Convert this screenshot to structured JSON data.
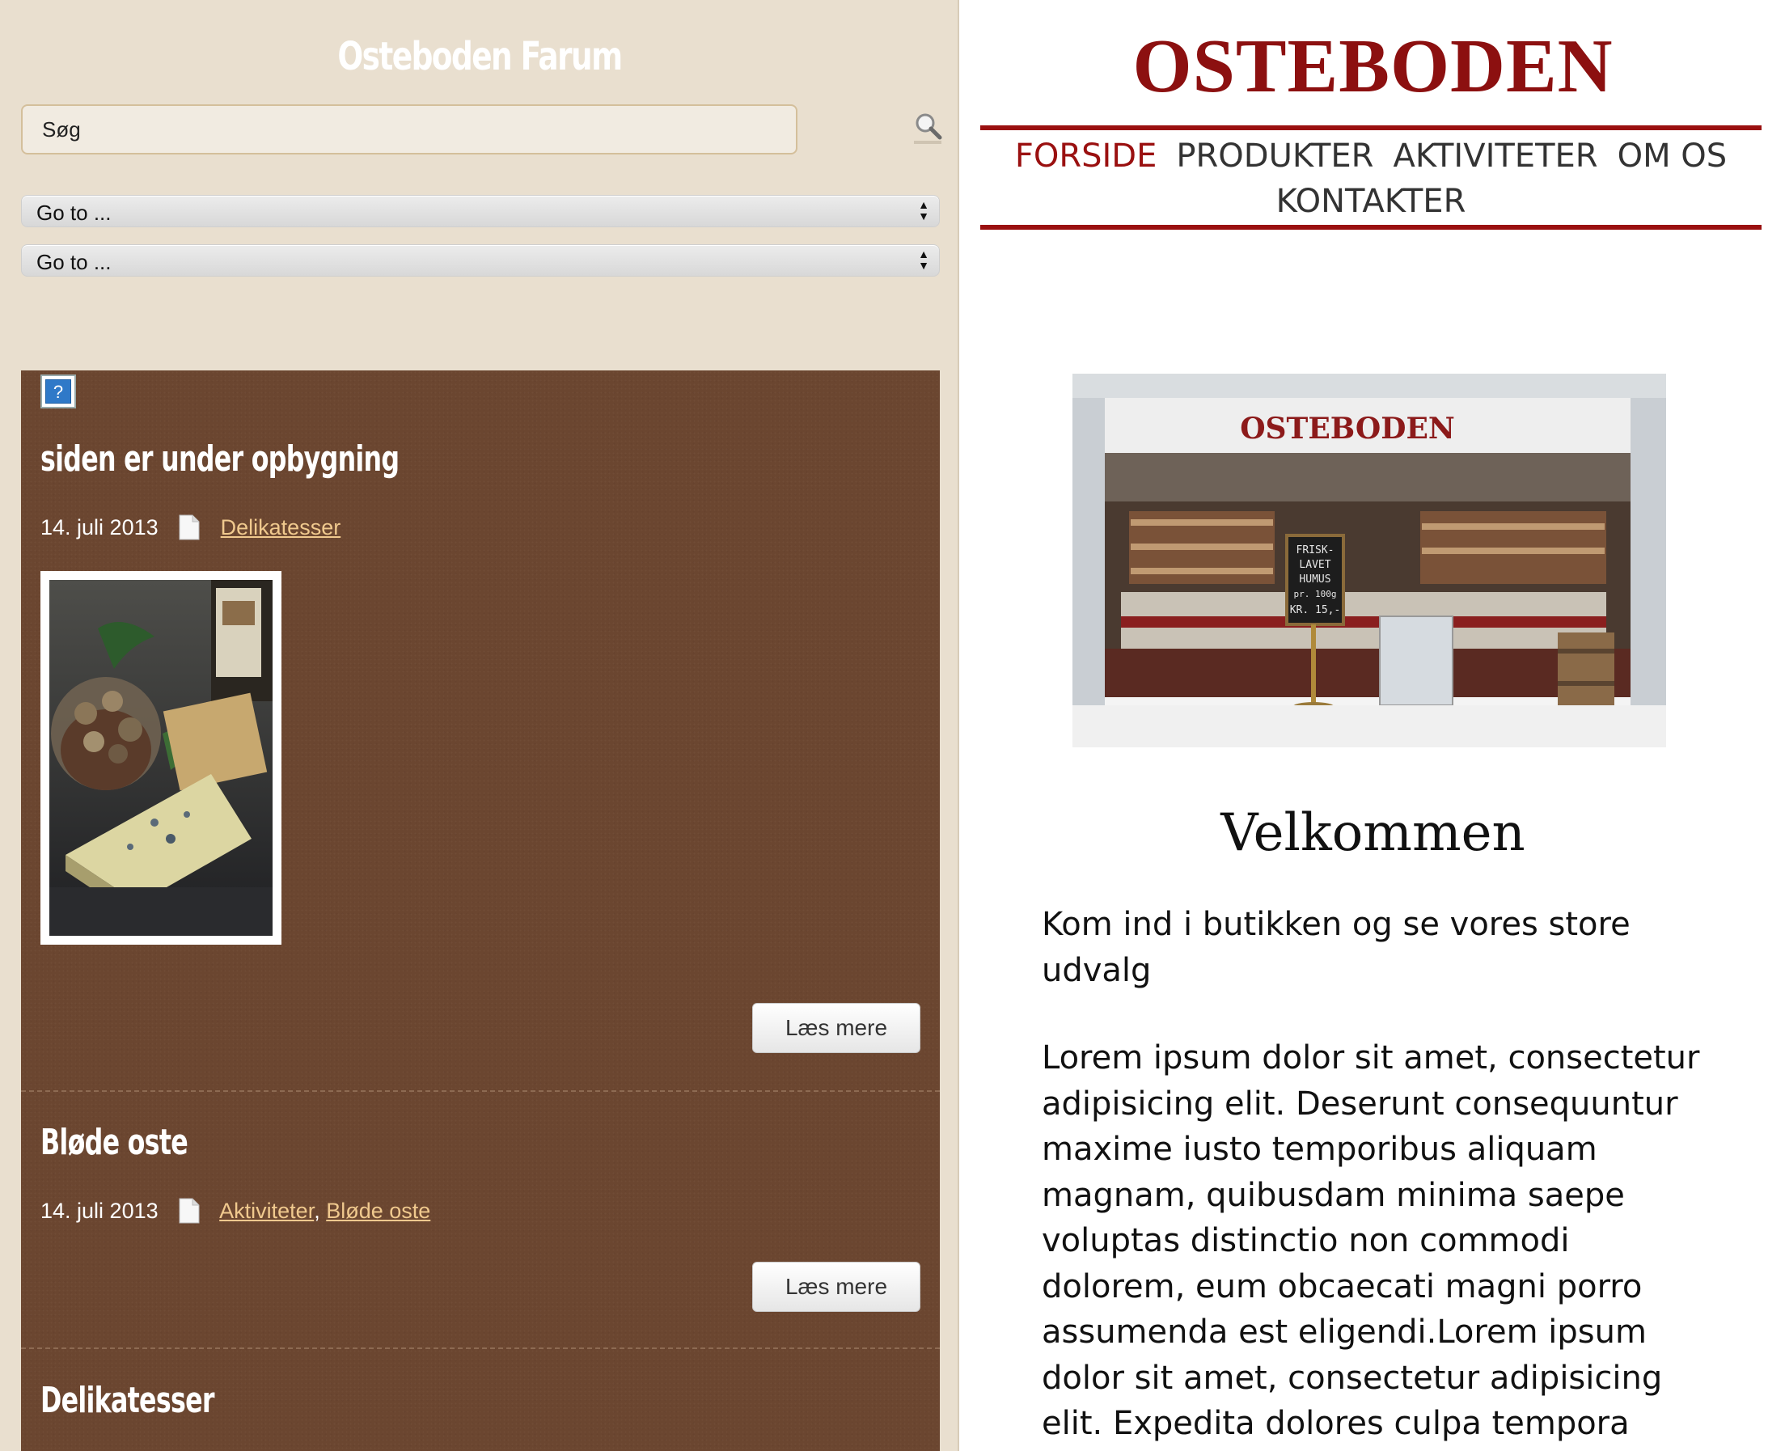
{
  "left": {
    "site_title": "Osteboden Farum",
    "search_placeholder": "Søg",
    "goto_1": "Go to ...",
    "goto_2": "Go to ...",
    "posts": [
      {
        "title": "siden er under opbygning",
        "date": "14. juli 2013",
        "categories": [
          "Delikatesser"
        ],
        "read_more": "Læs mere"
      },
      {
        "title": "Bløde oste",
        "date": "14. juli 2013",
        "categories": [
          "Aktiviteter",
          "Bløde oste"
        ],
        "category_separator": ",",
        "read_more": "Læs mere"
      },
      {
        "title": "Delikatesser"
      }
    ]
  },
  "right": {
    "brand": "OSTEBODEN",
    "nav": [
      "FORSIDE",
      "PRODUKTER",
      "AKTIVITETER",
      "OM OS",
      "KONTAKTER"
    ],
    "photo_sign": "OSTEBODEN",
    "photo_chalkboard": [
      "FRISK-",
      "LAVET",
      "HUMUS",
      "pr. 100g",
      "KR. 15,-"
    ],
    "welcome": "Velkommen",
    "lead": "Kom ind i butikken og se vores store udvalg",
    "body": "Lorem ipsum dolor sit amet, consectetur adipisicing elit. Deserunt consequuntur maxime iusto temporibus aliquam magnam, quibusdam minima saepe voluptas distinctio non commodi dolorem, eum obcaecati magni porro assumenda est eligendi.Lorem ipsum dolor sit amet, consectetur adipisicing elit. Expedita dolores culpa tempora ducimus quae, nisi"
  },
  "colors": {
    "left_bg": "#e9dfcf",
    "content_brown": "#6b4630",
    "link": "#f0c98e",
    "brand_red": "#8c1010"
  }
}
